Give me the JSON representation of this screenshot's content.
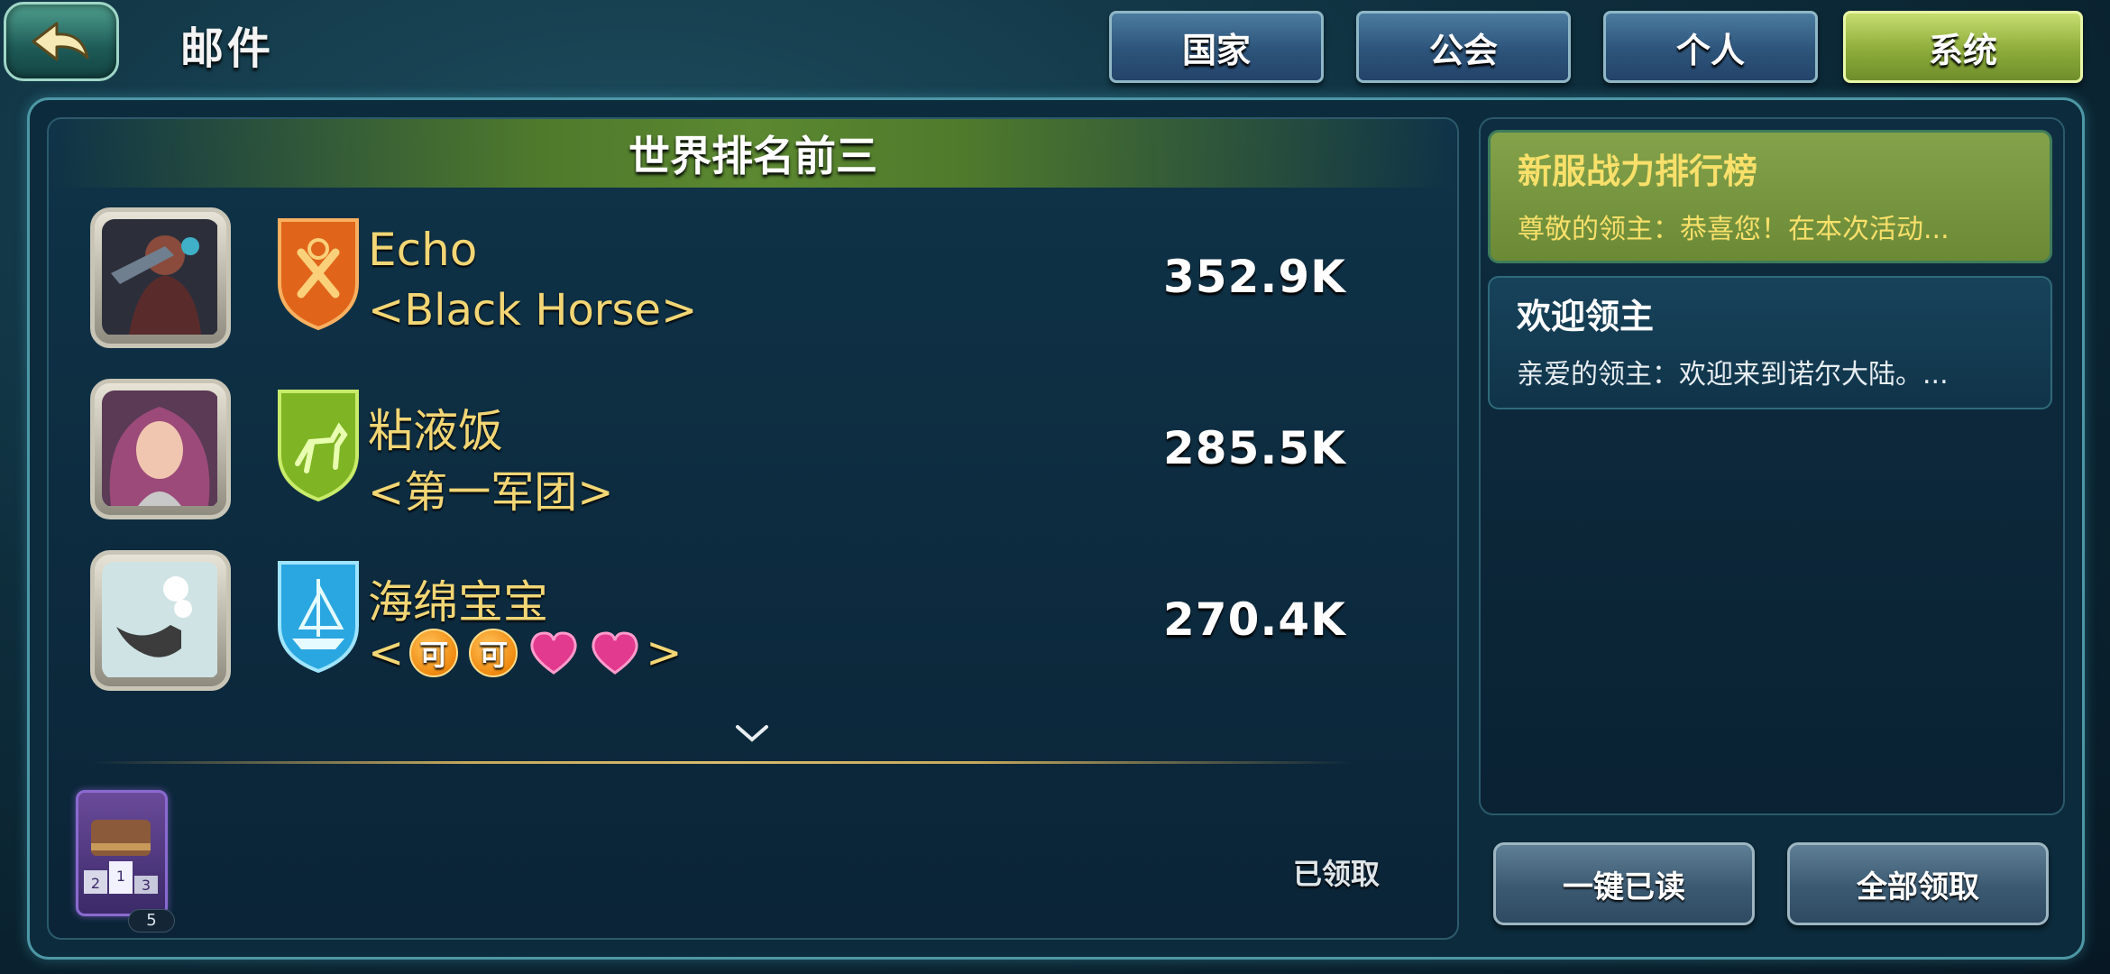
{
  "header": {
    "title": "邮件",
    "back_icon": "back-arrow-icon"
  },
  "tabs": [
    {
      "label": "国家",
      "active": false
    },
    {
      "label": "公会",
      "active": false
    },
    {
      "label": "个人",
      "active": false
    },
    {
      "label": "系统",
      "active": true
    }
  ],
  "mail": {
    "heading": "世界排名前三",
    "rankings": [
      {
        "name": "Echo",
        "guild": "<Black Horse>",
        "power": "352.9K",
        "shield_color": "#e0651a"
      },
      {
        "name": "粘液饭",
        "guild": "<第一军团>",
        "power": "285.5K",
        "shield_color": "#7fb424"
      },
      {
        "name": "海绵宝宝",
        "guild_prefix": "<",
        "guild_suffix": ">",
        "guild_coin": "可",
        "power": "270.4K",
        "shield_color": "#2aa7e0"
      }
    ],
    "more_icon": "chevron-down-icon",
    "attachment_count": "5",
    "attachment_digits": [
      "2",
      "1",
      "3"
    ],
    "claimed_label": "已领取"
  },
  "mail_list": [
    {
      "subject": "新服战力排行榜",
      "preview": "尊敬的领主：恭喜您！在本次活动...",
      "selected": true
    },
    {
      "subject": "欢迎领主",
      "preview": "亲爱的领主：欢迎来到诺尔大陆。...",
      "selected": false
    }
  ],
  "actions": {
    "mark_all_read": "一键已读",
    "claim_all": "全部领取"
  },
  "colors": {
    "gold_text": "#f2d675",
    "active_tab": "#8dac3a",
    "selected_mail": "#6c8a36"
  }
}
